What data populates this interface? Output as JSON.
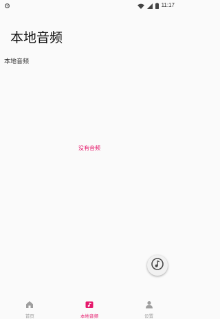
{
  "status_bar": {
    "time": "11:17"
  },
  "header": {
    "title": "本地音频"
  },
  "main": {
    "section_label": "本地音频",
    "empty_message": "没有音频"
  },
  "fab": {
    "icon": "music-note-icon"
  },
  "bottom_nav": {
    "items": [
      {
        "label": "首页",
        "icon": "home-icon",
        "active": false
      },
      {
        "label": "本地音频",
        "icon": "music-folder-icon",
        "active": true
      },
      {
        "label": "设置",
        "icon": "person-icon",
        "active": false
      }
    ]
  },
  "colors": {
    "accent": "#e5186b",
    "inactive": "#9e9e9e",
    "background": "#fafafa"
  }
}
